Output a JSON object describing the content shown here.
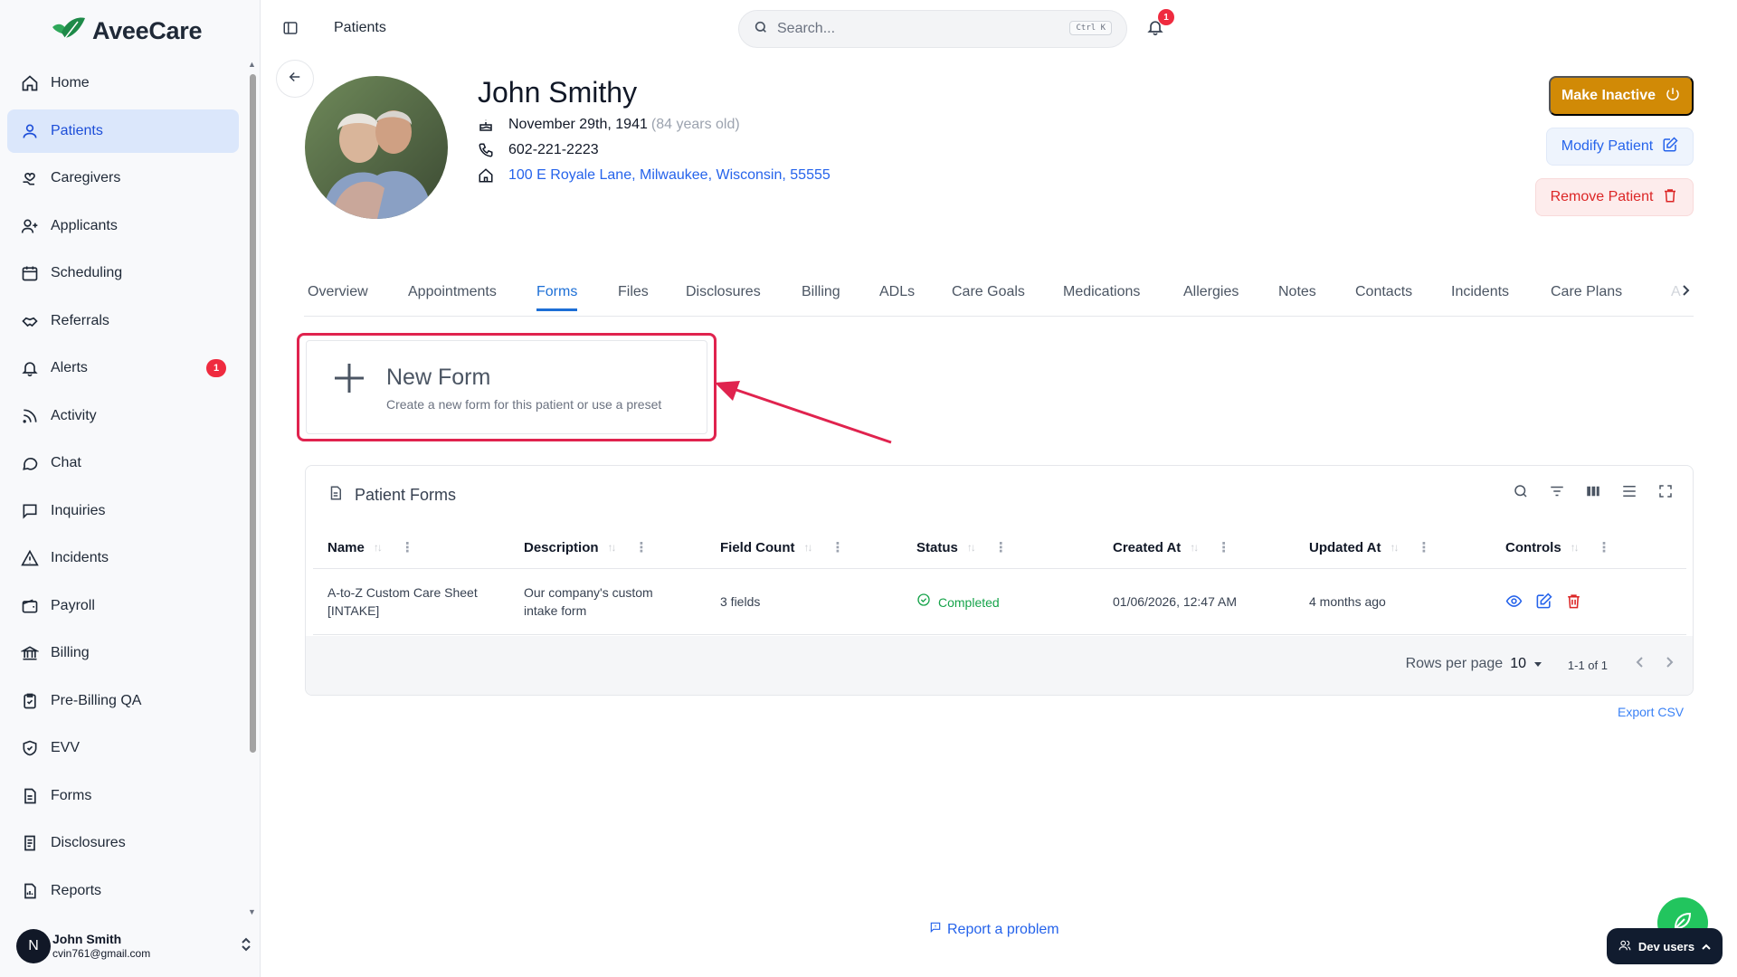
{
  "app": {
    "brand": "AveeCare",
    "brand_color": "#22a05a"
  },
  "sidebar": {
    "items": [
      {
        "label": "Home",
        "icon": "home-icon"
      },
      {
        "label": "Patients",
        "icon": "user-icon",
        "active": true
      },
      {
        "label": "Caregivers",
        "icon": "heart-hand-icon"
      },
      {
        "label": "Applicants",
        "icon": "user-plus-icon"
      },
      {
        "label": "Scheduling",
        "icon": "calendar-icon"
      },
      {
        "label": "Referrals",
        "icon": "handshake-icon"
      },
      {
        "label": "Alerts",
        "icon": "bell-icon",
        "badge": "1"
      },
      {
        "label": "Activity",
        "icon": "rss-icon"
      },
      {
        "label": "Chat",
        "icon": "chat-bubble-icon"
      },
      {
        "label": "Inquiries",
        "icon": "message-square-icon"
      },
      {
        "label": "Incidents",
        "icon": "warning-triangle-icon"
      },
      {
        "label": "Payroll",
        "icon": "wallet-icon"
      },
      {
        "label": "Billing",
        "icon": "bank-icon"
      },
      {
        "label": "Pre-Billing QA",
        "icon": "clipboard-check-icon"
      },
      {
        "label": "EVV",
        "icon": "shield-check-icon"
      },
      {
        "label": "Forms",
        "icon": "document-icon"
      },
      {
        "label": "Disclosures",
        "icon": "document-text-icon"
      },
      {
        "label": "Reports",
        "icon": "report-icon"
      }
    ],
    "user": {
      "initial": "N",
      "name": "John Smith",
      "email": "cvin761@gmail.com"
    }
  },
  "header": {
    "breadcrumb": "Patients",
    "search_placeholder": "Search...",
    "search_shortcut": "Ctrl K",
    "notifications_count": "1"
  },
  "patient": {
    "name": "John Smithy",
    "dob": "November 29th, 1941",
    "age": "(84 years old)",
    "phone": "602-221-2223",
    "address": "100 E Royale Lane, Milwaukee, Wisconsin, 55555"
  },
  "actions": {
    "make_inactive": "Make Inactive",
    "modify": "Modify Patient",
    "remove": "Remove Patient"
  },
  "tabs": [
    "Overview",
    "Appointments",
    "Forms",
    "Files",
    "Disclosures",
    "Billing",
    "ADLs",
    "Care Goals",
    "Medications",
    "Allergies",
    "Notes",
    "Contacts",
    "Incidents",
    "Care Plans"
  ],
  "tabs_overflow": "A",
  "active_tab": "Forms",
  "new_form": {
    "title": "New Form",
    "subtitle": "Create a new form for this patient or use a preset"
  },
  "patient_forms": {
    "title": "Patient Forms",
    "columns": [
      "Name",
      "Description",
      "Field Count",
      "Status",
      "Created At",
      "Updated At",
      "Controls"
    ],
    "rows": [
      {
        "name_line1": "A-to-Z Custom Care Sheet",
        "name_line2": "[INTAKE]",
        "desc_line1": "Our company's custom",
        "desc_line2": "intake form",
        "field_count": "3 fields",
        "status": "Completed",
        "created_at": "01/06/2026, 12:47 AM",
        "updated_at": "4 months ago"
      }
    ],
    "rows_per_page_label": "Rows per page",
    "rows_per_page": "10",
    "range": "1-1 of 1",
    "export": "Export CSV"
  },
  "footer": {
    "report": "Report a problem",
    "dev_users": "Dev users"
  },
  "colors": {
    "accent": "#2563eb",
    "inactive_btn": "#d18a06",
    "remove": "#dc2626",
    "highlight": "#e0234e",
    "success": "#16a34a"
  }
}
